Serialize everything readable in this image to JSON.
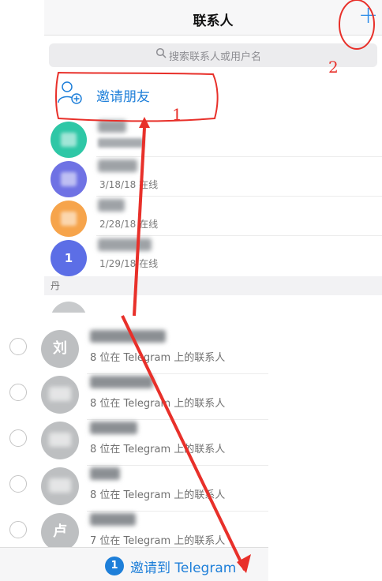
{
  "header": {
    "title": "联系人",
    "add_glyph": "+"
  },
  "search": {
    "placeholder": "搜索联系人或用户名"
  },
  "invite_friends": {
    "label": "邀请朋友",
    "icon": "add-person-icon"
  },
  "contacts": [
    {
      "status": "",
      "avatar_color": "#2ec7a6"
    },
    {
      "status": "3/18/18 在线",
      "avatar_color": "#6f72e4"
    },
    {
      "status": "2/28/18 在线",
      "avatar_color": "#f6a44b"
    },
    {
      "status": "1/29/18 在线",
      "avatar_color": "#5c6ee6",
      "avatar_initial": "1"
    }
  ],
  "section": {
    "label": "丹"
  },
  "phone_contacts": [
    {
      "initial": "刘",
      "subtitle": "8 位在 Telegram 上的联系人"
    },
    {
      "initial": "",
      "subtitle": "8 位在 Telegram 上的联系人"
    },
    {
      "initial": "",
      "subtitle": "8 位在 Telegram 上的联系人"
    },
    {
      "initial": "",
      "subtitle": "8 位在 Telegram 上的联系人"
    },
    {
      "initial": "卢",
      "subtitle": "7 位在 Telegram 上的联系人"
    }
  ],
  "bottom_bar": {
    "label": "邀请到 Telegram",
    "badge": "1"
  },
  "annotations": {
    "label_1": "1",
    "label_2": "2",
    "color": "#e8302a"
  },
  "colors": {
    "accent": "#1e7fd9"
  }
}
